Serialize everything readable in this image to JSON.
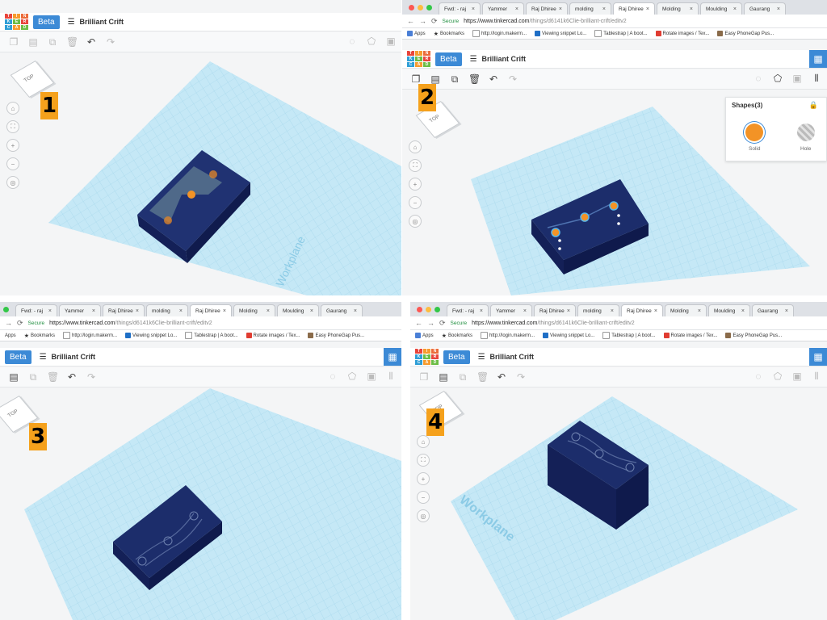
{
  "browser": {
    "tabs": [
      "Fwd: - raj",
      "Yammer",
      "Raj Dhiree",
      "molding",
      "Raj Dhiree",
      "Molding",
      "Moulding",
      "Gaurang"
    ],
    "secure_label": "Secure",
    "url": "https://www.tinkercad.com/things/d6141k6Clie-brilliant-crift/editv2",
    "url_host": "https://www.tinkercad.com",
    "url_path": "/things/d6141k6Clie-brilliant-crift/editv2",
    "bookmarks": [
      "Apps",
      "Bookmarks",
      "http://login.makerm...",
      "Viewing snippet Lo...",
      "Tablestrap | A boot...",
      "Rotate images / Tex...",
      "Easy PhoneGap Pus..."
    ]
  },
  "app": {
    "logo": [
      "T",
      "I",
      "N",
      "K",
      "E",
      "R",
      "C",
      "A",
      "D"
    ],
    "beta_label": "Beta",
    "design_name": "Brilliant Crift"
  },
  "toolbar": {
    "icons": [
      "copy-icon",
      "paste-icon",
      "duplicate-icon",
      "delete-icon",
      "undo-icon",
      "redo-icon"
    ],
    "right_icons": [
      "light-icon",
      "shape-icon",
      "group-icon"
    ]
  },
  "viewcube": {
    "face_label": "TOP"
  },
  "shapes_panel": {
    "title": "Shapes(3)",
    "solid_label": "Solid",
    "hole_label": "Hole"
  },
  "workplane_label": "Workplane",
  "steps": [
    "1",
    "2",
    "3",
    "4"
  ],
  "colors": {
    "workplane": "#bfe6f5",
    "grid": "#9fd3ea",
    "box_top": "#1e2e6e",
    "box_side": "#152257",
    "accent": "#3c8ad6",
    "step_badge": "#f5a11c",
    "solid": "#f39326"
  }
}
